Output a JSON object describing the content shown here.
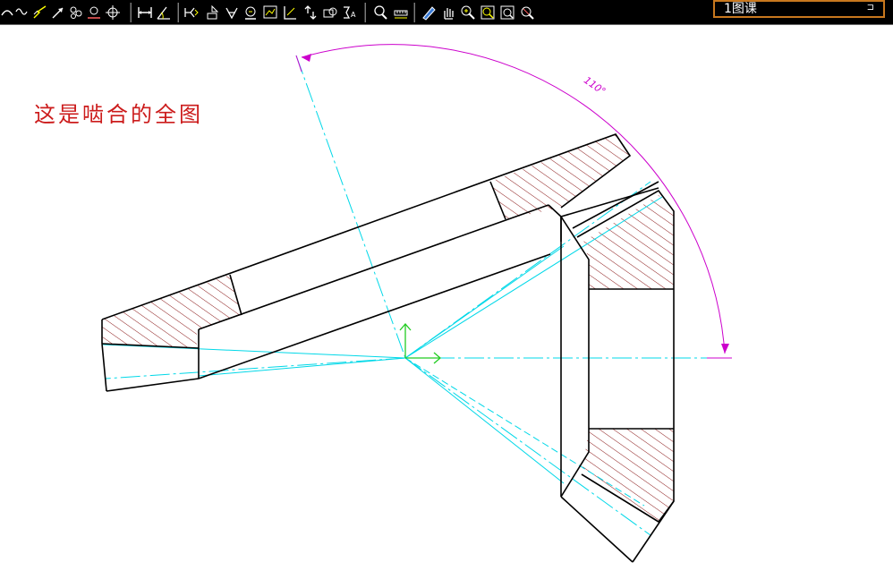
{
  "toolbar": {
    "icons": [
      "arc-icon",
      "wave-line-icon",
      "break-line-icon",
      "arrow-icon",
      "cloud-line-icon",
      "circle-center-icon",
      "crosshair-icon",
      "linear-dimension-icon",
      "angular-dimension-icon",
      "weld-symbol-icon",
      "datum-symbol-icon",
      "tolerance-symbol-icon",
      "surface-roughness-icon",
      "image-frame-icon",
      "leader-icon",
      "balloon-icon",
      "detail-view-icon",
      "text-icon",
      "query-icon",
      "measure-icon",
      "pencil-icon",
      "pan-icon",
      "zoom-realtime-icon",
      "zoom-window-icon",
      "zoom-all-icon",
      "zoom-previous-icon"
    ],
    "layer_value": "1图课",
    "layer_arrow": "⊐"
  },
  "colors": {
    "toolbar_bg": "#000000",
    "drawing_bg": "#ffffff",
    "outline": "#000000",
    "hatch": "#8b1a1a",
    "centerline": "#00d8e8",
    "dimension": "#cc00cc",
    "note_text": "#cc1c1c",
    "ucs_axis": "#22cc22",
    "layer_border": "#c8781e"
  },
  "drawing": {
    "note": "这是啮合的全图",
    "angle_dimension": "110°"
  }
}
